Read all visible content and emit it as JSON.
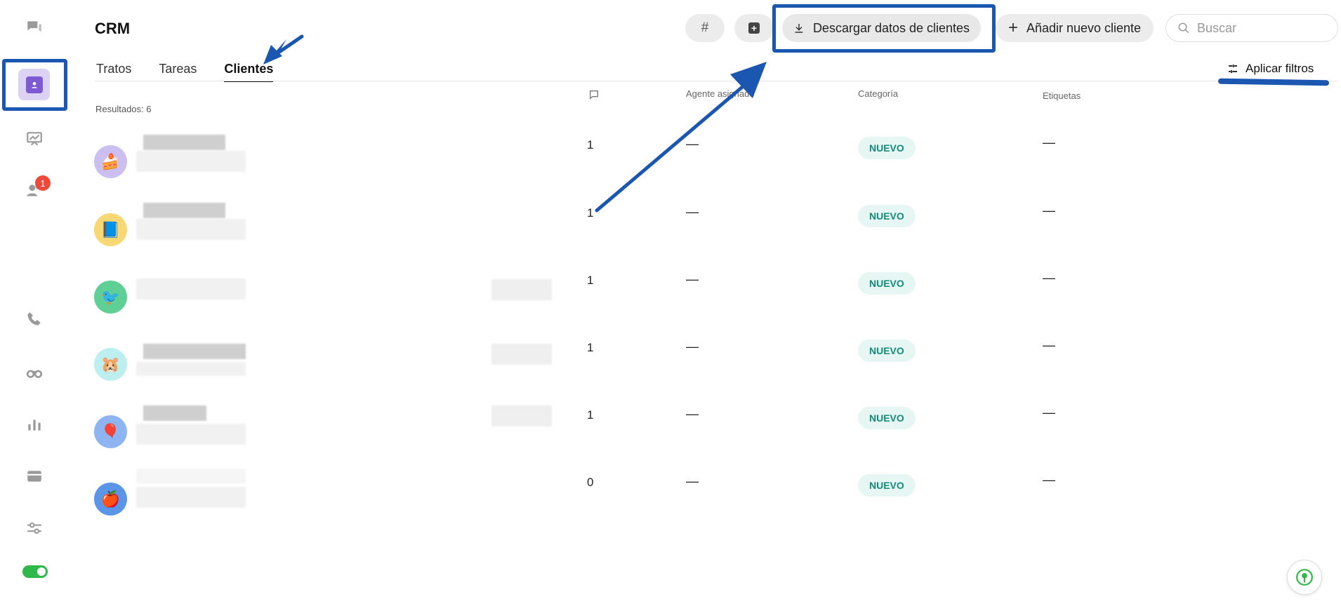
{
  "page": {
    "title": "CRM"
  },
  "header": {
    "hash_label": "#",
    "download_label": "Descargar datos de clientes",
    "add_label": "Añadir nuevo cliente",
    "search_placeholder": "Buscar"
  },
  "tabs": [
    {
      "label": "Tratos",
      "active": false
    },
    {
      "label": "Tareas",
      "active": false
    },
    {
      "label": "Clientes",
      "active": true
    }
  ],
  "filters": {
    "label": "Aplicar filtros"
  },
  "results_label": "Resultados: 6",
  "columns": {
    "agent": "Agente asignado",
    "category": "Categoría",
    "tags": "Etiquetas"
  },
  "sidebar": {
    "notifications_badge": "1"
  },
  "rows": [
    {
      "emoji": "🍰",
      "avatar_color": "#cbbef0",
      "count": "1",
      "agent": "—",
      "category": "NUEVO",
      "tags": "—"
    },
    {
      "emoji": "📘",
      "avatar_color": "#f7d875",
      "count": "1",
      "agent": "—",
      "category": "NUEVO",
      "tags": "—"
    },
    {
      "emoji": "🐦",
      "avatar_color": "#5fcf95",
      "count": "1",
      "agent": "—",
      "category": "NUEVO",
      "tags": "—"
    },
    {
      "emoji": "🐹",
      "avatar_color": "#bdeff0",
      "count": "1",
      "agent": "—",
      "category": "NUEVO",
      "tags": "—"
    },
    {
      "emoji": "🎈",
      "avatar_color": "#8fb4f2",
      "count": "1",
      "agent": "—",
      "category": "NUEVO",
      "tags": "—"
    },
    {
      "emoji": "🍎",
      "avatar_color": "#5a95e8",
      "count": "0",
      "agent": "—",
      "category": "NUEVO",
      "tags": "—"
    }
  ],
  "colors": {
    "accent": "#7d5ad3",
    "annotation": "#1b56b0",
    "badge": "#ee4a3c",
    "category_text": "#13897a",
    "toggle": "#2eb84a"
  }
}
